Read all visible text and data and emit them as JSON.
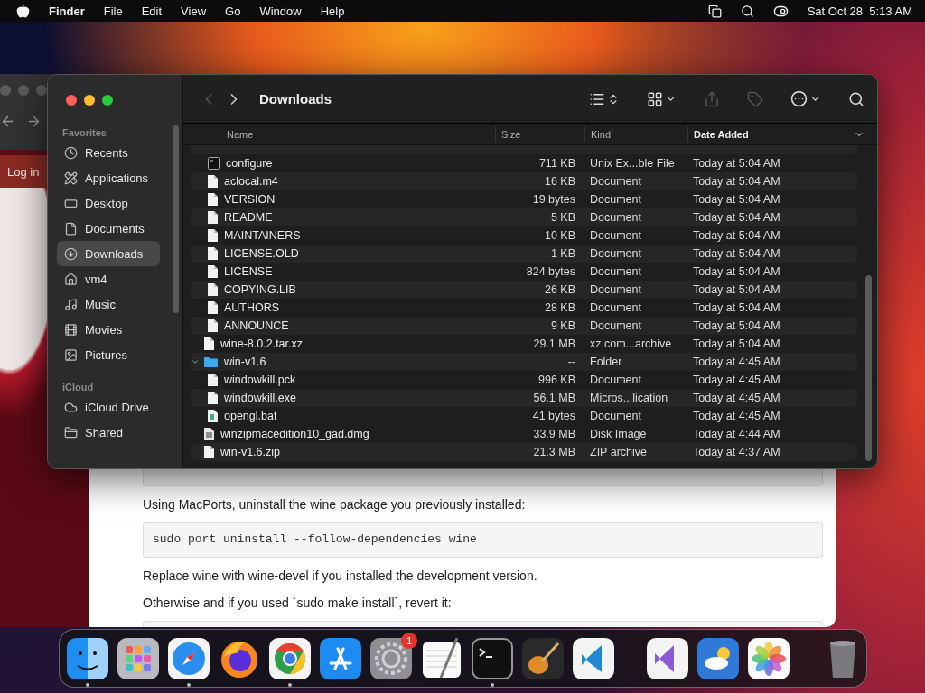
{
  "menubar": {
    "app": "Finder",
    "menus": [
      "File",
      "Edit",
      "View",
      "Go",
      "Window",
      "Help"
    ],
    "datetime": "Sat Oct 28  5:13 AM"
  },
  "browser": {
    "login": "Log in",
    "blocks": [
      {
        "kind": "code"
      },
      {
        "kind": "text",
        "text": "Using MacPorts, uninstall the wine package you previously installed:"
      },
      {
        "kind": "code",
        "text": "sudo port uninstall --follow-dependencies wine"
      },
      {
        "kind": "text",
        "text": "Replace wine with wine-devel if you installed the development version."
      },
      {
        "kind": "text",
        "text": "Otherwise and if you used `sudo make install`, revert it:"
      },
      {
        "kind": "code"
      }
    ]
  },
  "finder": {
    "title": "Downloads",
    "sidebar": [
      {
        "heading": "Favorites",
        "items": [
          {
            "label": "Recents",
            "selected": false
          },
          {
            "label": "Applications",
            "selected": false
          },
          {
            "label": "Desktop",
            "selected": false
          },
          {
            "label": "Documents",
            "selected": false
          },
          {
            "label": "Downloads",
            "selected": true
          },
          {
            "label": "vm4",
            "selected": false
          },
          {
            "label": "Music",
            "selected": false
          },
          {
            "label": "Movies",
            "selected": false
          },
          {
            "label": "Pictures",
            "selected": false
          }
        ]
      },
      {
        "heading": "iCloud",
        "items": [
          {
            "label": "iCloud Drive",
            "selected": false
          },
          {
            "label": "Shared",
            "selected": false
          }
        ]
      }
    ],
    "columns": [
      {
        "label": "Name",
        "sorted": false
      },
      {
        "label": "Size",
        "sorted": false
      },
      {
        "label": "Kind",
        "sorted": false
      },
      {
        "label": "Date Added",
        "sorted": true
      }
    ],
    "rows": [
      {
        "children": [
          {
            "name": "configure",
            "size": "711 KB",
            "type": "Unix Ex...ble File",
            "date": "Today at 5:04 AM",
            "kind": "executable"
          },
          {
            "name": "aclocal.m4",
            "size": "16 KB",
            "type": "Document",
            "date": "Today at 5:04 AM",
            "kind": "document"
          },
          {
            "name": "VERSION",
            "size": "19 bytes",
            "type": "Document",
            "date": "Today at 5:04 AM",
            "kind": "document"
          },
          {
            "name": "README",
            "size": "5 KB",
            "type": "Document",
            "date": "Today at 5:04 AM",
            "kind": "document"
          },
          {
            "name": "MAINTAINERS",
            "size": "10 KB",
            "type": "Document",
            "date": "Today at 5:04 AM",
            "kind": "document"
          },
          {
            "name": "LICENSE.OLD",
            "size": "1 KB",
            "type": "Document",
            "date": "Today at 5:04 AM",
            "kind": "document"
          },
          {
            "name": "LICENSE",
            "size": "824 bytes",
            "type": "Document",
            "date": "Today at 5:04 AM",
            "kind": "document"
          },
          {
            "name": "COPYING.LIB",
            "size": "26 KB",
            "type": "Document",
            "date": "Today at 5:04 AM",
            "kind": "document"
          },
          {
            "name": "AUTHORS",
            "size": "28 KB",
            "type": "Document",
            "date": "Today at 5:04 AM",
            "kind": "document"
          },
          {
            "name": "ANNOUNCE",
            "size": "9 KB",
            "type": "Document",
            "date": "Today at 5:04 AM",
            "kind": "document"
          }
        ]
      },
      {
        "name": "wine-8.0.2.tar.xz",
        "size": "29.1 MB",
        "type": "xz com...archive",
        "date": "Today at 5:04 AM",
        "kind": "document"
      },
      {
        "name": "win-v1.6",
        "size": "--",
        "type": "Folder",
        "date": "Today at 4:45 AM",
        "kind": "folder",
        "expanded": true,
        "children": [
          {
            "name": "windowkill.pck",
            "size": "996 KB",
            "type": "Document",
            "date": "Today at 4:45 AM",
            "kind": "document"
          },
          {
            "name": "windowkill.exe",
            "size": "56.1 MB",
            "type": "Micros...lication",
            "date": "Today at 4:45 AM",
            "kind": "document"
          },
          {
            "name": "opengl.bat",
            "size": "41 bytes",
            "type": "Document",
            "date": "Today at 4:45 AM",
            "kind": "script"
          }
        ]
      },
      {
        "name": "winzipmacedition10_gad.dmg",
        "size": "33.9 MB",
        "type": "Disk Image",
        "date": "Today at 4:44 AM",
        "kind": "disk-image"
      },
      {
        "name": "win-v1.6.zip",
        "size": "21.3 MB",
        "type": "ZIP archive",
        "date": "Today at 4:37 AM",
        "kind": "document"
      }
    ]
  },
  "dock": [
    [
      {
        "running": true
      },
      {
        "running": false
      },
      {
        "running": true
      },
      {
        "running": false
      },
      {
        "running": true
      },
      {
        "running": false
      },
      {
        "running": false,
        "badge": "1"
      },
      {
        "running": false
      },
      {
        "running": true
      },
      {
        "running": false
      },
      {
        "running": false
      }
    ],
    [
      {
        "running": false
      },
      {
        "running": false
      },
      {
        "running": false
      }
    ],
    [
      {
        "running": false
      }
    ]
  ]
}
